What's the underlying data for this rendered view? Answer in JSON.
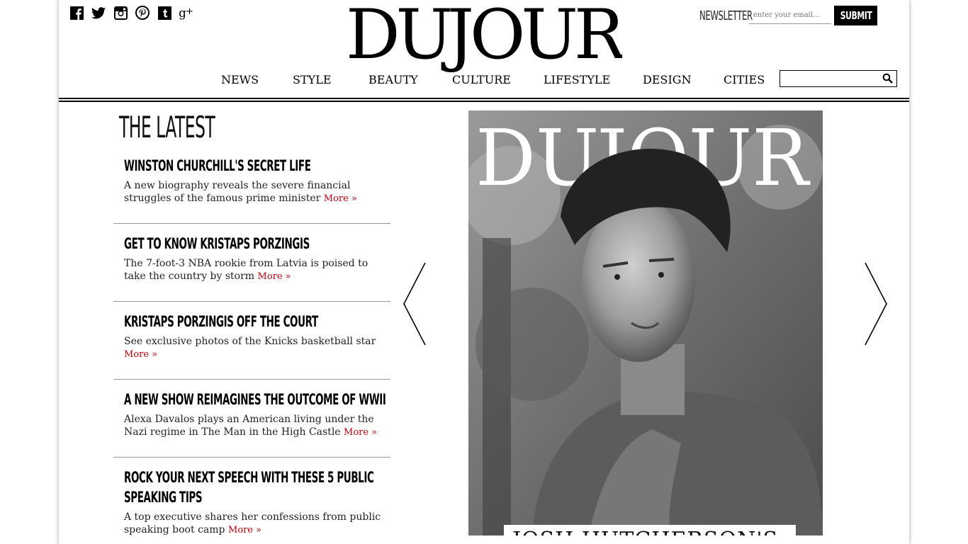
{
  "brand": {
    "name": "DUJOUR"
  },
  "social": [
    "facebook-icon",
    "twitter-icon",
    "instagram-icon",
    "pinterest-icon",
    "tumblr-icon",
    "googleplus-icon"
  ],
  "newsletter": {
    "label": "NEWSLETTER",
    "placeholder": "enter your email...",
    "submit": "SUBMIT"
  },
  "nav": [
    "NEWS",
    "STYLE",
    "BEAUTY",
    "CULTURE",
    "LIFESTYLE",
    "DESIGN",
    "CITIES"
  ],
  "search": {
    "placeholder": ""
  },
  "latest": {
    "heading": "THE LATEST",
    "articles": [
      {
        "title": "WINSTON CHURCHILL'S SECRET LIFE",
        "desc": "A new biography reveals the severe financial struggles of the famous prime minister",
        "more": "More »"
      },
      {
        "title": "GET TO KNOW KRISTAPS PORZINGIS",
        "desc": "The 7-foot-3 NBA rookie from Latvia is poised to take the country by storm",
        "more": "More »"
      },
      {
        "title": "KRISTAPS PORZINGIS OFF THE COURT",
        "desc": "See exclusive photos of the Knicks basketball star",
        "more": "More »"
      },
      {
        "title": "A NEW SHOW REIMAGINES THE OUTCOME OF WWII",
        "desc": "Alexa Davalos plays an American living under the Nazi regime in The Man in the High Castle",
        "more": "More »"
      },
      {
        "title": "ROCK YOUR NEXT SPEECH WITH THESE 5 PUBLIC",
        "title2": "SPEAKING TIPS",
        "desc": "A top executive shares her confessions from public speaking boot camp",
        "more": "More »"
      }
    ]
  },
  "feature": {
    "cover_logo": "DUJOUR",
    "caption": "JOSH HUTCHERSON'S"
  },
  "colors": {
    "accent": "#c4000c",
    "text": "#000000"
  }
}
